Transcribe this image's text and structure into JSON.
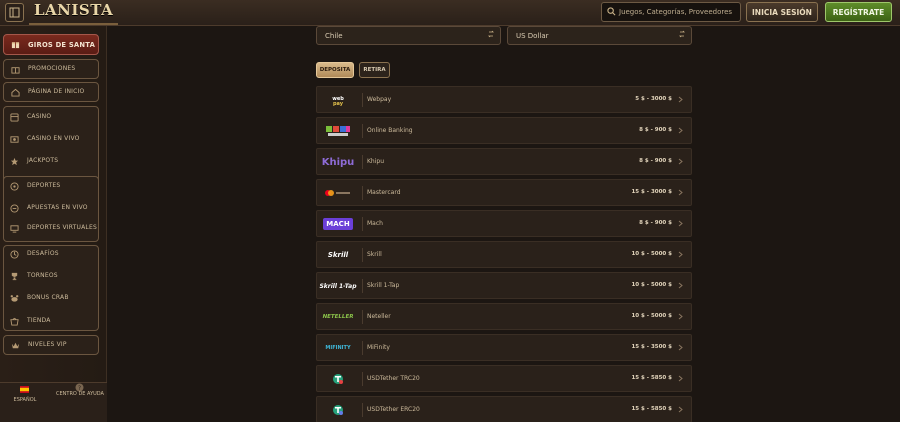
{
  "header": {
    "logo": "LANISTA",
    "search_placeholder": "Juegos, Categorías, Proveedores",
    "login_label": "INICIA SESIÓN",
    "register_label": "REGÍSTRATE"
  },
  "sidebar": {
    "items": [
      {
        "label": "GIROS DE SANTA",
        "icon": "gift-icon"
      },
      {
        "label": "PROMOCIONES",
        "icon": "gift-box-icon"
      },
      {
        "label": "PÁGINA DE INICIO",
        "icon": "home-icon"
      },
      {
        "label": "CASINO",
        "icon": "slot-icon"
      },
      {
        "label": "CASINO EN VIVO",
        "icon": "live-casino-icon"
      },
      {
        "label": "JACKPOTS",
        "icon": "jackpot-icon"
      },
      {
        "label": "DEPORTES",
        "icon": "soccer-ball-icon"
      },
      {
        "label": "APUESTAS EN VIVO",
        "icon": "live-bet-icon"
      },
      {
        "label": "DEPORTES VIRTUALES",
        "icon": "virtual-sports-icon"
      },
      {
        "label": "DESAFÍOS",
        "icon": "challenge-icon"
      },
      {
        "label": "TORNEOS",
        "icon": "trophy-icon"
      },
      {
        "label": "BONUS CRAB",
        "icon": "crab-icon"
      },
      {
        "label": "TIENDA",
        "icon": "shop-icon"
      },
      {
        "label": "NIVELES VIP",
        "icon": "vip-icon"
      }
    ],
    "footer": {
      "language": "ESPAÑOL",
      "help": "CENTRO DE AYUDA"
    }
  },
  "filters": {
    "country": "Chile",
    "currency": "US Dollar"
  },
  "tabs": {
    "deposit": "DEPOSITA",
    "withdraw": "RETIRA"
  },
  "methods": [
    {
      "name": "Webpay",
      "range": "5 $ - 3000 $",
      "logo": "webpay"
    },
    {
      "name": "Online Banking",
      "range": "8 $ - 900 $",
      "logo": "online-banking"
    },
    {
      "name": "Khipu",
      "range": "8 $ - 900 $",
      "logo": "Khipu"
    },
    {
      "name": "Mastercard",
      "range": "15 $ - 3000 $",
      "logo": "mastercard"
    },
    {
      "name": "Mach",
      "range": "8 $ - 900 $",
      "logo": "MACH"
    },
    {
      "name": "Skrill",
      "range": "10 $ - 5000 $",
      "logo": "Skrill"
    },
    {
      "name": "Skrill 1-Tap",
      "range": "10 $ - 5000 $",
      "logo": "Skrill 1-Tap"
    },
    {
      "name": "Neteller",
      "range": "10 $ - 5000 $",
      "logo": "NETELLER"
    },
    {
      "name": "MiFinity",
      "range": "15 $ - 3500 $",
      "logo": "MIFINITY"
    },
    {
      "name": "USDTether TRC20",
      "range": "15 $ - 5850 $",
      "logo": "tether"
    },
    {
      "name": "USDTether ERC20",
      "range": "15 $ - 5850 $",
      "logo": "tether"
    }
  ],
  "colors": {
    "accent": "#d9ba8b",
    "register": "#5f8d2a",
    "santa": "#7a2a1e"
  }
}
